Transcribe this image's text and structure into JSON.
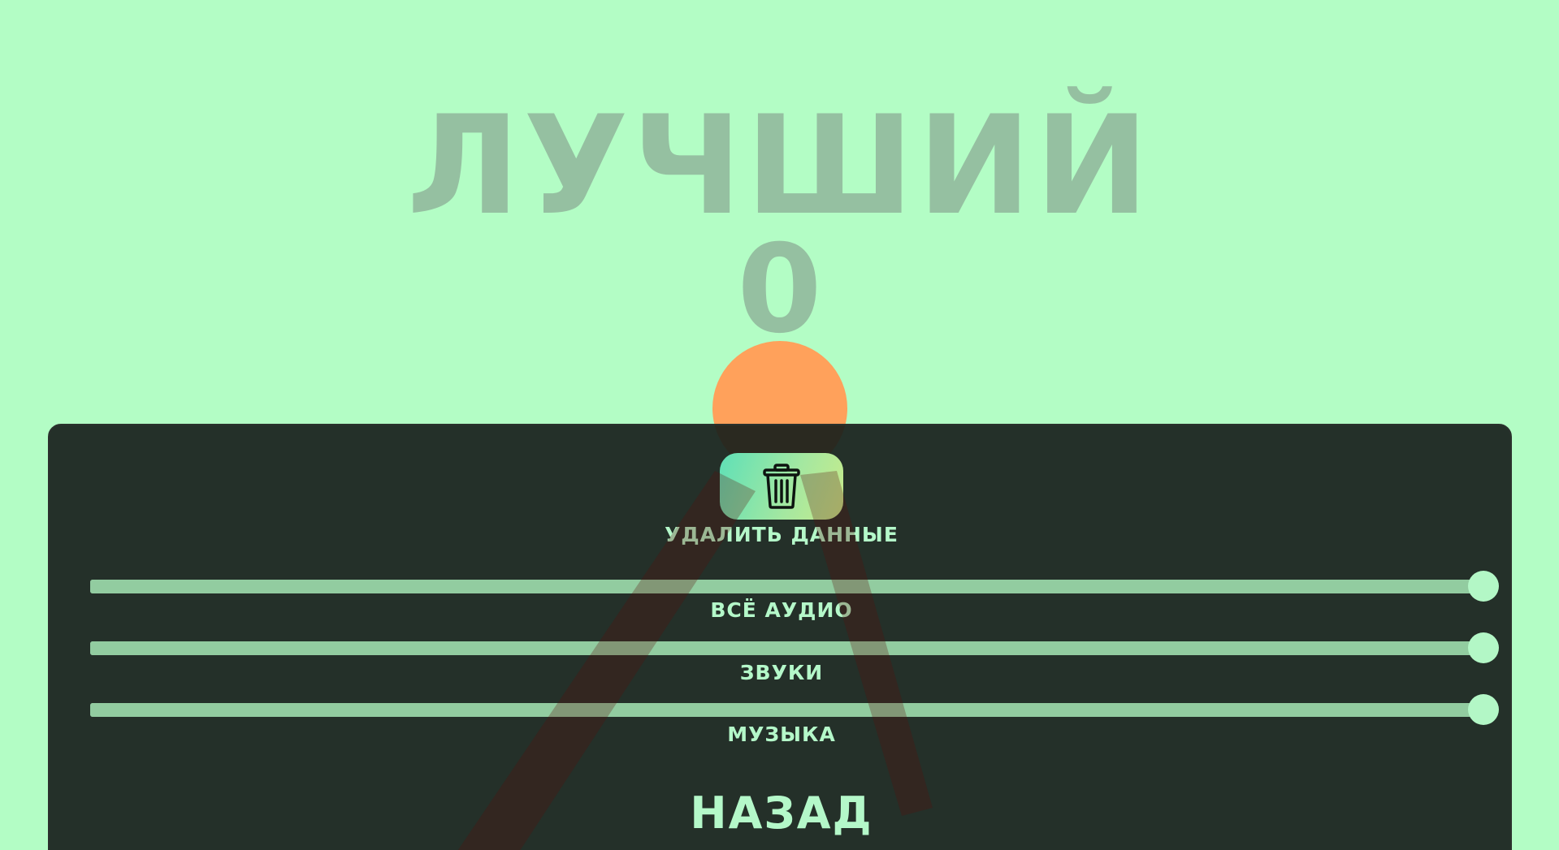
{
  "hud": {
    "best_label": "ЛУЧШИЙ",
    "best_score": "0"
  },
  "settings": {
    "delete_icon": "trash-icon",
    "delete_label": "УДАЛИТЬ ДАННЫЕ",
    "sliders": [
      {
        "label": "ВСЁ АУДИО",
        "value": 1.0
      },
      {
        "label": "ЗВУКИ",
        "value": 1.0
      },
      {
        "label": "МУЗЫКА",
        "value": 1.0
      }
    ],
    "back_label": "НАЗАД"
  },
  "colors": {
    "background": "#b3fdc5",
    "title_text": "#95c0a1",
    "ball": "#ffa15b",
    "panel": "#181e1b",
    "accent_text": "#b4f8c9",
    "slider_track": "#92cca0",
    "slider_thumb": "#b3f7c6",
    "stick": "#5a0f0a"
  }
}
